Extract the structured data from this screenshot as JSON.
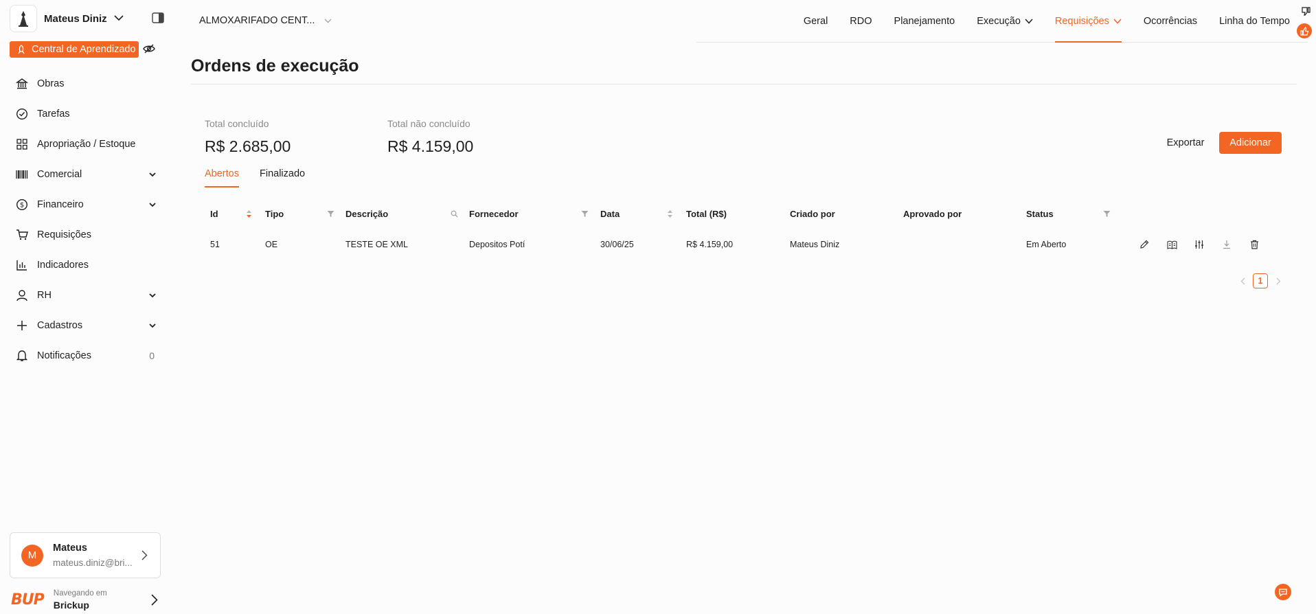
{
  "org": {
    "name": "Mateus Diniz"
  },
  "learning": {
    "label": "Central de Aprendizado"
  },
  "sidebar": {
    "items": [
      {
        "label": "Obras"
      },
      {
        "label": "Tarefas"
      },
      {
        "label": "Apropriação / Estoque"
      },
      {
        "label": "Comercial"
      },
      {
        "label": "Financeiro"
      },
      {
        "label": "Requisições"
      },
      {
        "label": "Indicadores"
      },
      {
        "label": "RH"
      },
      {
        "label": "Cadastros"
      },
      {
        "label": "Notificações",
        "count": "0"
      }
    ]
  },
  "user": {
    "initial": "M",
    "name": "Mateus",
    "email": "mateus.diniz@bri..."
  },
  "brand": {
    "logo": "BUP",
    "caption": "Navegando em",
    "name": "Brickup"
  },
  "project": {
    "name": "ALMOXARIFADO CENT..."
  },
  "tabs": [
    {
      "label": "Geral"
    },
    {
      "label": "RDO"
    },
    {
      "label": "Planejamento"
    },
    {
      "label": "Execução"
    },
    {
      "label": "Requisições"
    },
    {
      "label": "Ocorrências"
    },
    {
      "label": "Linha do Tempo"
    }
  ],
  "page": {
    "title": "Ordens de execução"
  },
  "stats": {
    "completed_label": "Total concluído",
    "completed_value": "R$ 2.685,00",
    "open_label": "Total não concluído",
    "open_value": "R$ 4.159,00"
  },
  "actions": {
    "export": "Exportar",
    "add": "Adicionar"
  },
  "subtabs": [
    {
      "label": "Abertos"
    },
    {
      "label": "Finalizado"
    }
  ],
  "table": {
    "columns": [
      "Id",
      "Tipo",
      "Descrição",
      "Fornecedor",
      "Data",
      "Total (R$)",
      "Criado por",
      "Aprovado por",
      "Status"
    ],
    "rows": [
      {
        "id": "51",
        "tipo": "OE",
        "descricao": "TESTE OE XML",
        "fornecedor": "Depositos Potí",
        "data": "30/06/25",
        "total": "R$ 4.159,00",
        "criado_por": "Mateus Diniz",
        "aprovado_por": "",
        "status": "Em Aberto"
      }
    ]
  },
  "pagination": {
    "current": "1"
  },
  "colors": {
    "accent": "#f26522",
    "text": "#1f1f1f",
    "muted": "#8a8a8a",
    "border": "#e5e5e5"
  },
  "icons": [
    "org-logo",
    "chevron-down-icon",
    "panel-toggle-icon",
    "rocket-icon",
    "eye-off-icon",
    "bank-icon",
    "check-circle-icon",
    "grid-icon",
    "barcode-icon",
    "dollar-icon",
    "cart-icon",
    "bar-chart-icon",
    "user-icon",
    "plus-icon",
    "bell-icon",
    "chevron-right-icon",
    "thumbs-down-icon",
    "thumbs-up-icon",
    "sort-icon",
    "filter-icon",
    "search-icon",
    "edit-icon",
    "book-icon",
    "sliders-icon",
    "download-icon",
    "trash-icon",
    "chat-icon"
  ]
}
